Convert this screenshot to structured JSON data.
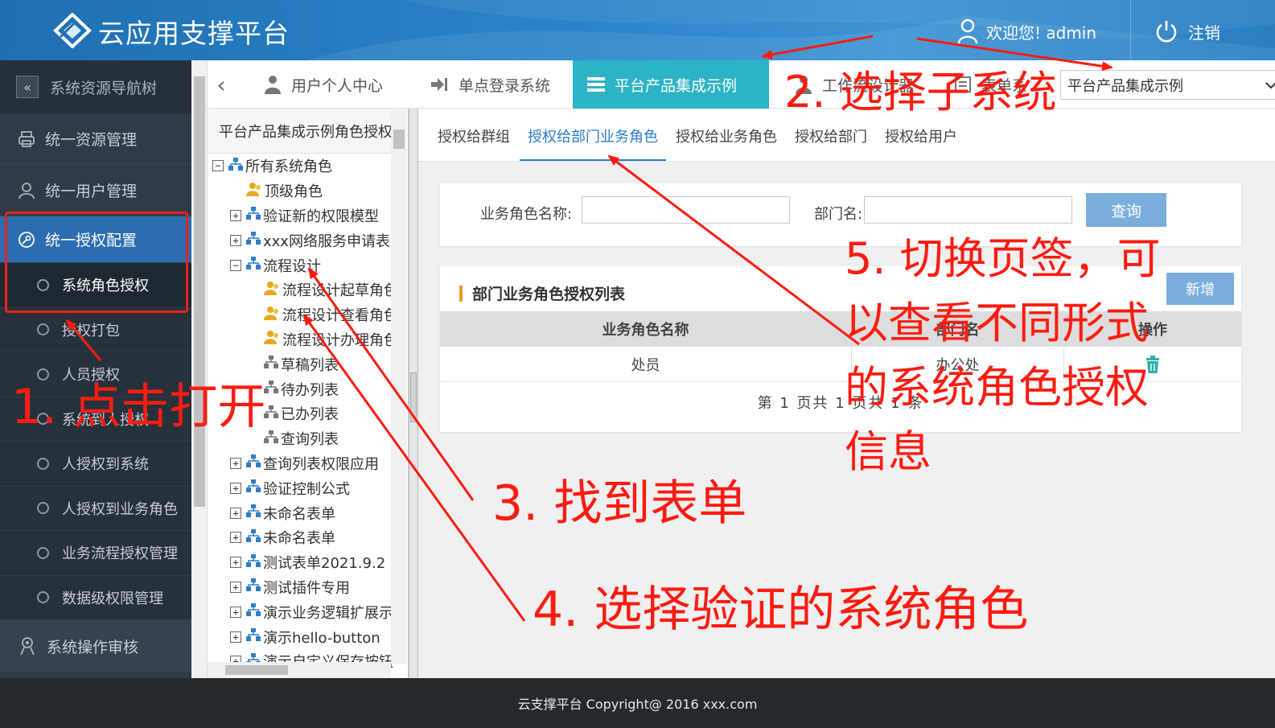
{
  "header": {
    "app_title": "云应用支撑平台",
    "welcome": "欢迎您! admin",
    "logout": "注销"
  },
  "sidebar": {
    "nav_title": "系统资源导航树",
    "items": [
      {
        "label": "统一资源管理",
        "icon": "printer-icon"
      },
      {
        "label": "统一用户管理",
        "icon": "user-icon"
      },
      {
        "label": "统一授权配置",
        "icon": "key-icon"
      }
    ],
    "subitems": [
      {
        "label": "系统角色授权"
      },
      {
        "label": "授权打包"
      },
      {
        "label": "人员授权"
      },
      {
        "label": "系统到人授权"
      },
      {
        "label": "人授权到系统"
      },
      {
        "label": "人授权到业务角色"
      },
      {
        "label": "业务流程授权管理"
      },
      {
        "label": "数据级权限管理"
      }
    ],
    "bottom_item": {
      "label": "系统操作审核",
      "icon": "audit-icon"
    }
  },
  "tabs": [
    {
      "label": "用户个人中心",
      "icon": "person-icon"
    },
    {
      "label": "单点登录系统",
      "icon": "login-icon"
    },
    {
      "label": "平台产品集成示例",
      "icon": "list-icon"
    },
    {
      "label": "工作流设计器",
      "icon": "person-icon"
    },
    {
      "label": "表单系",
      "icon": "form-icon"
    }
  ],
  "system_select": {
    "value": "平台产品集成示例"
  },
  "tree": {
    "header": "平台产品集成示例角色授权",
    "nodes": [
      {
        "label": "所有系统角色",
        "expander": "⊟",
        "level": 0,
        "icon": "org-icon"
      },
      {
        "label": "顶级角色",
        "expander": "",
        "level": 1,
        "icon": "role-icon"
      },
      {
        "label": "验证新的权限模型",
        "expander": "⊞",
        "level": 1,
        "icon": "org-icon"
      },
      {
        "label": "xxx网络服务申请表",
        "expander": "⊞",
        "level": 1,
        "icon": "org-icon"
      },
      {
        "label": "流程设计",
        "expander": "⊟",
        "level": 1,
        "icon": "org-icon"
      },
      {
        "label": "流程设计起草角色",
        "expander": "",
        "level": 2,
        "icon": "role-icon"
      },
      {
        "label": "流程设计查看角色",
        "expander": "",
        "level": 2,
        "icon": "role-icon"
      },
      {
        "label": "流程设计办理角色",
        "expander": "",
        "level": 2,
        "icon": "role-icon"
      },
      {
        "label": "草稿列表",
        "expander": "",
        "level": 2,
        "icon": "org-gray-icon"
      },
      {
        "label": "待办列表",
        "expander": "",
        "level": 2,
        "icon": "org-gray-icon"
      },
      {
        "label": "已办列表",
        "expander": "",
        "level": 2,
        "icon": "org-gray-icon"
      },
      {
        "label": "查询列表",
        "expander": "",
        "level": 2,
        "icon": "org-gray-icon"
      },
      {
        "label": "查询列表权限应用",
        "expander": "⊞",
        "level": 1,
        "icon": "org-icon"
      },
      {
        "label": "验证控制公式",
        "expander": "⊞",
        "level": 1,
        "icon": "org-icon"
      },
      {
        "label": "未命名表单",
        "expander": "⊞",
        "level": 1,
        "icon": "org-icon"
      },
      {
        "label": "未命名表单",
        "expander": "⊞",
        "level": 1,
        "icon": "org-icon"
      },
      {
        "label": "测试表单2021.9.2",
        "expander": "⊞",
        "level": 1,
        "icon": "org-icon"
      },
      {
        "label": "测试插件专用",
        "expander": "⊞",
        "level": 1,
        "icon": "org-icon"
      },
      {
        "label": "演示业务逻辑扩展示例",
        "expander": "⊞",
        "level": 1,
        "icon": "org-icon"
      },
      {
        "label": "演示hello-button",
        "expander": "⊞",
        "level": 1,
        "icon": "org-icon"
      },
      {
        "label": "演示自定义保存按钮",
        "expander": "⊞",
        "level": 1,
        "icon": "org-icon"
      }
    ]
  },
  "subtabs": [
    "授权给群组",
    "授权给部门业务角色",
    "授权给业务角色",
    "授权给部门",
    "授权给用户"
  ],
  "search": {
    "role_label": "业务角色名称:",
    "dept_label": "部门名:",
    "button": "查询"
  },
  "grid": {
    "title": "部门业务角色授权列表",
    "add_button": "新增",
    "columns": [
      "业务角色名称",
      "部门名",
      "操作"
    ],
    "rows": [
      {
        "role": "处员",
        "dept": "办公处",
        "action_icon": "trash-icon"
      }
    ],
    "pager": "第 1 页共 1 页共 1 条"
  },
  "footer": "云支撑平台 Copyright@ 2016 xxx.com",
  "annotations": {
    "step1": "1. 点击打开",
    "step2": "2. 选择子系统",
    "step3": "3. 找到表单",
    "step4": "4. 选择验证的系统角色",
    "step5": [
      "5. 切换页签，可",
      "以查看不同形式",
      "的系统角色授权",
      "信息"
    ]
  },
  "colors": {
    "header_blue": "#2a84c9",
    "sidebar_bg": "#2f3b47",
    "active_tab": "#2cb3c6",
    "button_blue": "#7aaedc",
    "annotation_red": "#ff1a10"
  }
}
